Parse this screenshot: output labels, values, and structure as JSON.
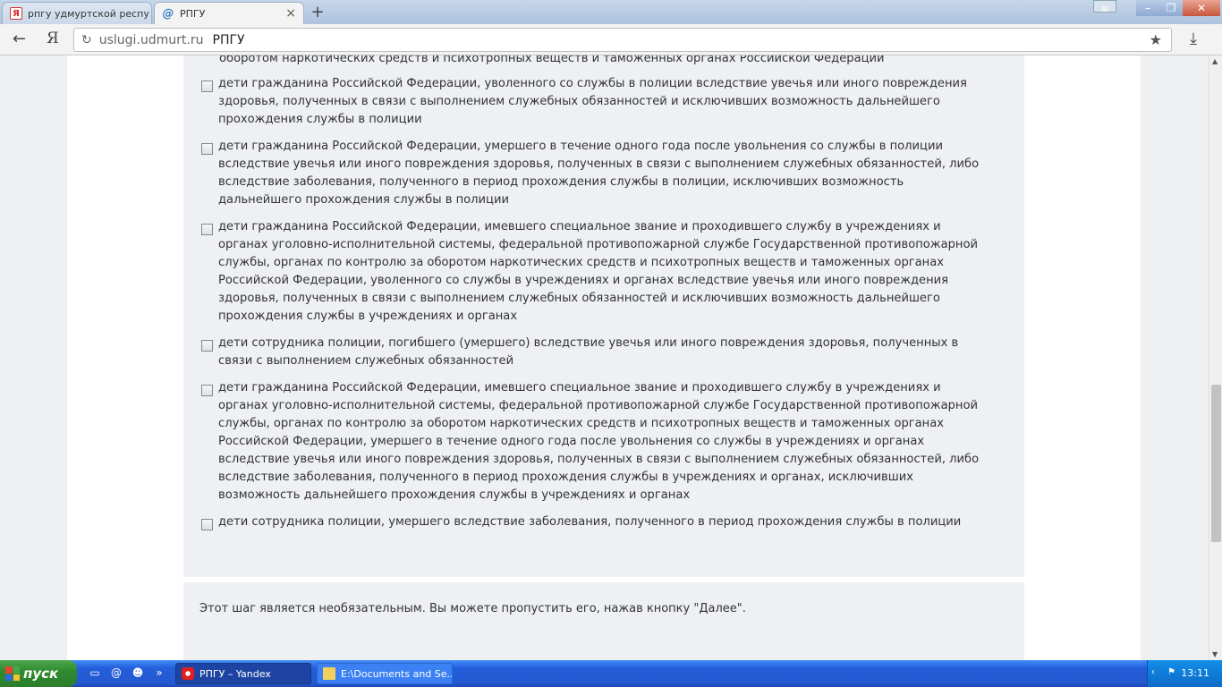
{
  "browser": {
    "tabs": [
      {
        "label": "рпгу удмуртской респу",
        "icon": "yandex-search-icon"
      },
      {
        "label": "РПГУ",
        "icon": "rpgu-icon"
      }
    ],
    "address": {
      "host": "uslugi.udmurt.ru",
      "page_title": "РПГУ"
    }
  },
  "page": {
    "option_top_fragment": "оборотом наркотических средств и психотропных веществ и таможенных органах Российской Федерации",
    "options": [
      "дети гражданина Российской Федерации, уволенного со службы в полиции вследствие увечья или иного повреждения здоровья, полученных в связи с выполнением служебных обязанностей и исключивших возможность дальнейшего прохождения службы в полиции",
      "дети гражданина Российской Федерации, умершего в течение одного года после увольнения со службы в полиции вследствие увечья или иного повреждения здоровья, полученных в связи с выполнением служебных обязанностей, либо вследствие заболевания, полученного в период прохождения службы в полиции, исключивших возможность дальнейшего прохождения службы в полиции",
      "дети гражданина Российской Федерации, имевшего специальное звание и проходившего службу в учреждениях и органах уголовно-исполнительной системы, федеральной противопожарной службе Государственной противопожарной службы, органах по контролю за оборотом наркотических средств и психотропных веществ и таможенных органах Российской Федерации, уволенного со службы в учреждениях и органах вследствие увечья или иного повреждения здоровья, полученных в связи с выполнением служебных обязанностей и исключивших возможность дальнейшего прохождения службы в учреждениях и органах",
      "дети сотрудника полиции, погибшего (умершего) вследствие увечья или иного повреждения здоровья, полученных в связи с выполнением служебных обязанностей",
      "дети гражданина Российской Федерации, имевшего специальное звание и проходившего службу в учреждениях и органах уголовно-исполнительной системы, федеральной противопожарной службе Государственной противопожарной службы, органах по контролю за оборотом наркотических средств и психотропных веществ и таможенных органах Российской Федерации, умершего в течение одного года после увольнения со службы в учреждениях и органах вследствие увечья или иного повреждения здоровья, полученных в связи с выполнением служебных обязанностей, либо вследствие заболевания, полученного в период прохождения службы в учреждениях и органах, исключивших возможность дальнейшего прохождения службы в учреждениях и органах",
      "дети сотрудника полиции, умершего вследствие заболевания, полученного в период прохождения службы в полиции"
    ],
    "note": "Этот шаг является необязательным. Вы можете пропустить его, нажав кнопку \"Далее\"."
  },
  "taskbar": {
    "start_label": "пуск",
    "buttons": [
      {
        "label": "РПГУ – Yandex",
        "icon": "yandex-browser-icon",
        "active": true
      },
      {
        "label": "E:\\Documents and Se...",
        "icon": "folder-icon",
        "active": false
      }
    ],
    "clock": "13:11"
  },
  "colors": {
    "taskbar": "#245edb",
    "start": "#2f8b2f",
    "panel": "#eef0f3"
  }
}
